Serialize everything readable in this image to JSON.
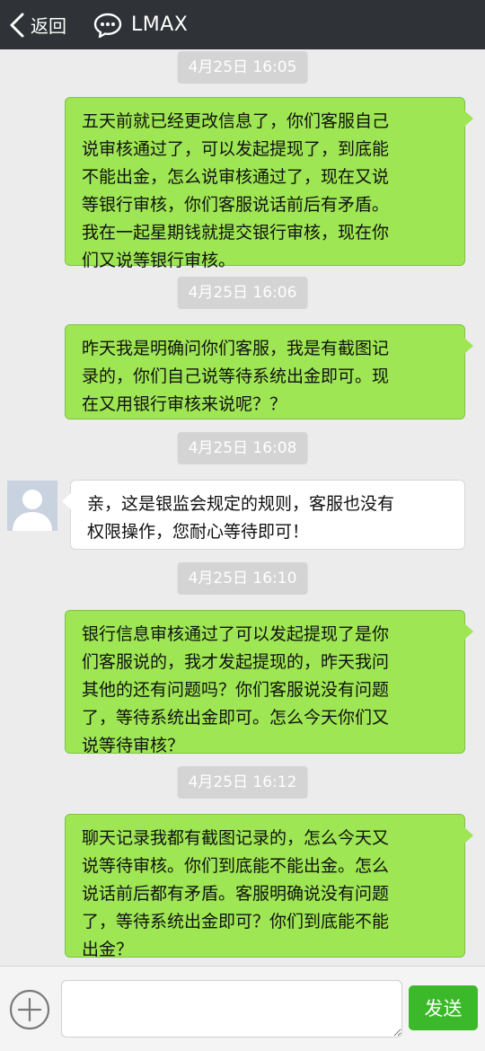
{
  "header": {
    "back_label": "返回",
    "title": "LMAX",
    "icons": [
      "back-chevron-icon",
      "chat-bubble-icon"
    ]
  },
  "messages": [
    {
      "kind": "timestamp",
      "text": "4月25日 16:05"
    },
    {
      "kind": "sent",
      "text": "五天前就已经更改信息了，你们客服自己\n说审核通过了，可以发起提现了，到底能\n不能出金，怎么说审核通过了，现在又说\n等银行审核，你们客服说话前后有矛盾。\n我在一起星期钱就提交银行审核，现在你\n们又说等银行审核。"
    },
    {
      "kind": "timestamp",
      "text": "4月25日 16:06"
    },
    {
      "kind": "sent",
      "text": "昨天我是明确问你们客服，我是有截图记\n录的，你们自己说等待系统出金即可。现\n在又用银行审核来说呢？？"
    },
    {
      "kind": "timestamp",
      "text": "4月25日 16:08"
    },
    {
      "kind": "received",
      "text": "亲，这是银监会规定的规则，客服也没有\n权限操作，您耐心等待即可！"
    },
    {
      "kind": "timestamp",
      "text": "4月25日 16:10"
    },
    {
      "kind": "sent",
      "text": "银行信息审核通过了可以发起提现了是你\n们客服说的，我才发起提现的，昨天我问\n其他的还有问题吗？你们客服说没有问题\n了，等待系统出金即可。怎么今天你们又\n说等待审核？"
    },
    {
      "kind": "timestamp",
      "text": "4月25日 16:12"
    },
    {
      "kind": "sent",
      "text": "聊天记录我都有截图记录的，怎么今天又\n说等待审核。你们到底能不能出金。怎么\n说话前后都有矛盾。客服明确说没有问题\n了，等待系统出金即可？你们到底能不能\n出金？"
    }
  ],
  "input": {
    "value": "",
    "placeholder": "",
    "send_label": "发送",
    "plus_icon": "plus-circle-icon"
  },
  "colors": {
    "header_bg": "#2f3236",
    "sent_bubble": "#9ee653",
    "received_bubble": "#ffffff",
    "send_button": "#3cb92a",
    "background": "#ececec"
  }
}
